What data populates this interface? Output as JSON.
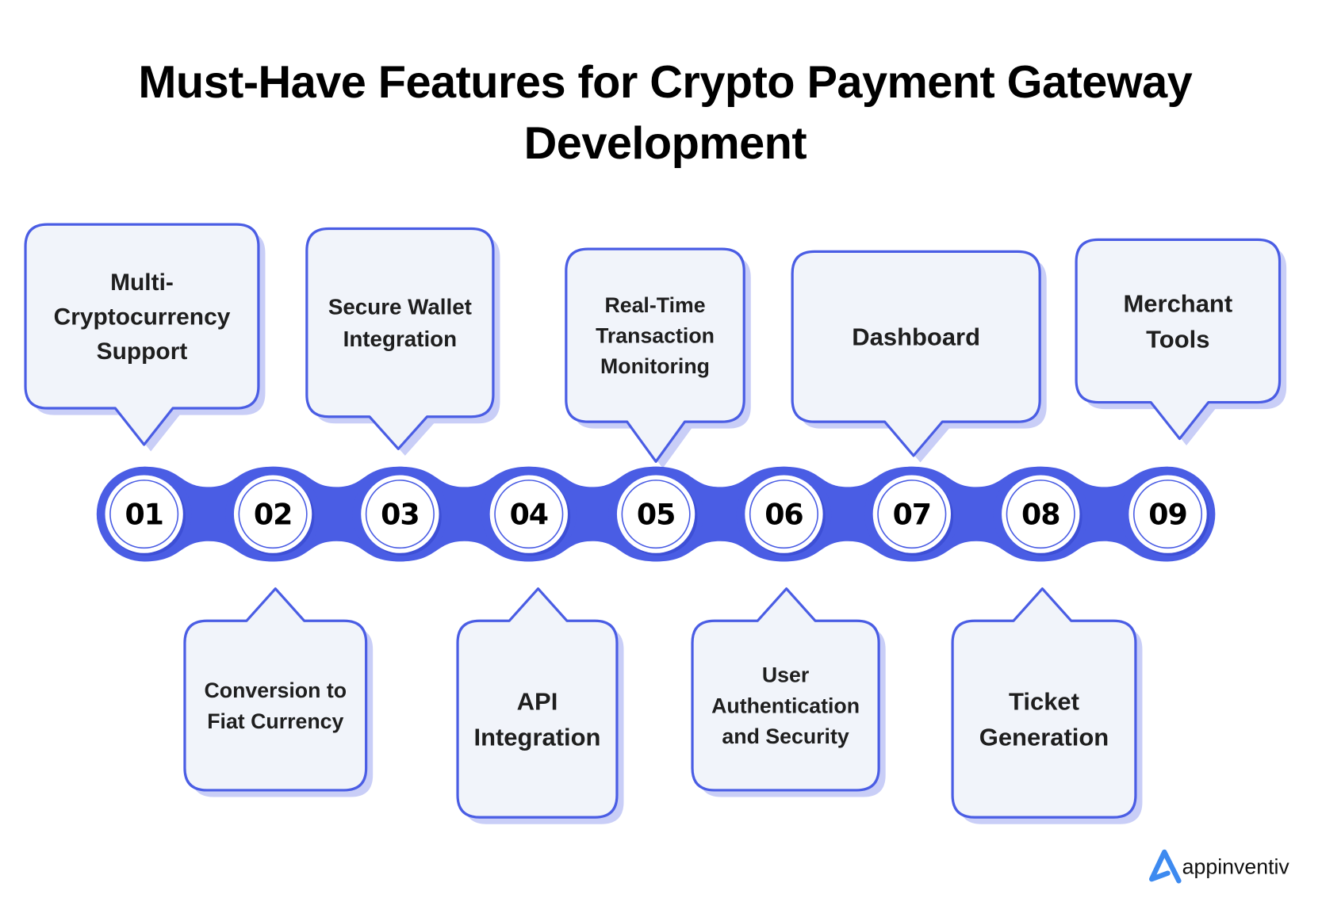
{
  "title": {
    "line1": "Must-Have Features for Crypto Payment Gateway",
    "line2": "Development"
  },
  "colors": {
    "accent": "#4a5de4",
    "accent_light": "#c9cef7",
    "box_fill": "#f1f4fa",
    "text": "#1e1e1e",
    "logo": "#3d8af0"
  },
  "features": [
    {
      "number": "01",
      "position": "top",
      "lines": [
        "Multi-",
        "Cryptocurrency",
        "Support"
      ]
    },
    {
      "number": "02",
      "position": "bottom",
      "lines": [
        "Conversion to",
        "Fiat Currency"
      ]
    },
    {
      "number": "03",
      "position": "top",
      "lines": [
        "Secure Wallet",
        "Integration"
      ]
    },
    {
      "number": "04",
      "position": "bottom",
      "lines": [
        "API",
        "Integration"
      ]
    },
    {
      "number": "05",
      "position": "top",
      "lines": [
        "Real-Time",
        "Transaction",
        "Monitoring"
      ]
    },
    {
      "number": "06",
      "position": "bottom",
      "lines": [
        "User",
        "Authentication",
        "and Security"
      ]
    },
    {
      "number": "07",
      "position": "top",
      "lines": [
        "Dashboard"
      ]
    },
    {
      "number": "08",
      "position": "bottom",
      "lines": [
        "Ticket",
        "Generation"
      ]
    },
    {
      "number": "09",
      "position": "top",
      "lines": [
        "Merchant",
        "Tools"
      ]
    }
  ],
  "brand": {
    "name": "appinventiv",
    "icon": "appinventiv-logo-icon"
  }
}
